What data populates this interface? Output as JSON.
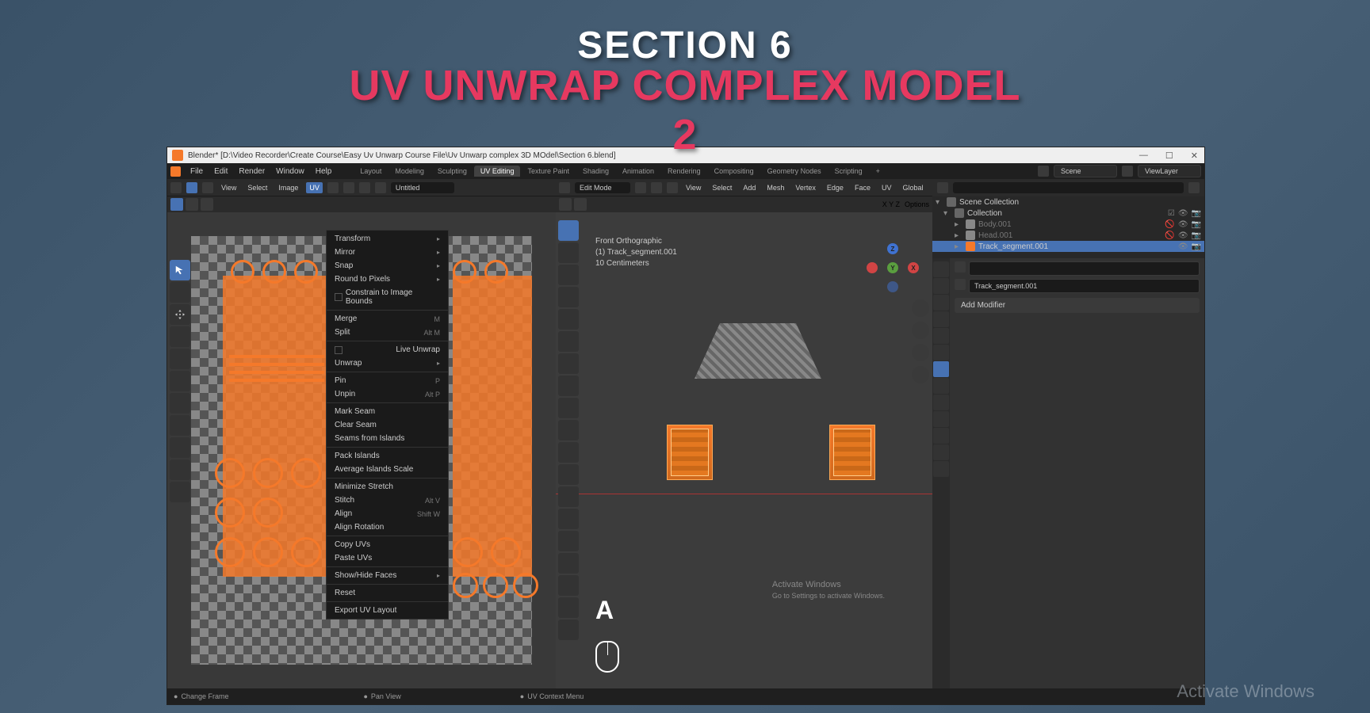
{
  "overlay": {
    "section": "SECTION 6",
    "title": "UV UNWRAP COMPLEX MODEL 2"
  },
  "titlebar": {
    "text": "Blender* [D:\\Video Recorder\\Create Course\\Easy Uv Unwarp Course File\\Uv Unwarp complex 3D MOdel\\Section 6.blend]"
  },
  "topMenu": [
    "File",
    "Edit",
    "Render",
    "Window",
    "Help"
  ],
  "workspaces": [
    "Layout",
    "Modeling",
    "Sculpting",
    "UV Editing",
    "Texture Paint",
    "Shading",
    "Animation",
    "Rendering",
    "Compositing",
    "Geometry Nodes",
    "Scripting"
  ],
  "activeWorkspace": "UV Editing",
  "sceneField": {
    "label": "Scene",
    "value": "Scene"
  },
  "viewLayerField": {
    "label": "ViewLayer",
    "value": "ViewLayer"
  },
  "uvHeader": {
    "menus": [
      "View",
      "Select",
      "Image",
      "UV"
    ],
    "imageName": "Untitled"
  },
  "uvMenu": {
    "items": [
      {
        "label": "Transform",
        "sub": true
      },
      {
        "label": "Mirror",
        "sub": true
      },
      {
        "label": "Snap",
        "sub": true
      },
      {
        "label": "Round to Pixels",
        "sub": true
      },
      {
        "label": "Constrain to Image Bounds",
        "check": true
      },
      {
        "sep": true
      },
      {
        "label": "Merge",
        "shortcut": "M",
        "sub": true
      },
      {
        "label": "Split",
        "shortcut": "Alt M",
        "sub": true
      },
      {
        "sep": true
      },
      {
        "label": "Live Unwrap",
        "check": true
      },
      {
        "label": "Unwrap",
        "sub": true
      },
      {
        "sep": true
      },
      {
        "label": "Pin",
        "shortcut": "P"
      },
      {
        "label": "Unpin",
        "shortcut": "Alt P"
      },
      {
        "sep": true
      },
      {
        "label": "Mark Seam"
      },
      {
        "label": "Clear Seam"
      },
      {
        "label": "Seams from Islands"
      },
      {
        "sep": true
      },
      {
        "label": "Pack Islands"
      },
      {
        "label": "Average Islands Scale"
      },
      {
        "sep": true
      },
      {
        "label": "Minimize Stretch"
      },
      {
        "label": "Stitch",
        "shortcut": "Alt V"
      },
      {
        "label": "Align",
        "shortcut": "Shift W",
        "sub": true
      },
      {
        "label": "Align Rotation"
      },
      {
        "sep": true
      },
      {
        "label": "Copy UVs"
      },
      {
        "label": "Paste UVs"
      },
      {
        "sep": true
      },
      {
        "label": "Show/Hide Faces",
        "sub": true
      },
      {
        "sep": true
      },
      {
        "label": "Reset"
      },
      {
        "sep": true
      },
      {
        "label": "Export UV Layout"
      }
    ]
  },
  "viewportHeader": {
    "mode": "Edit Mode",
    "menus": [
      "View",
      "Select",
      "Add",
      "Mesh",
      "Vertex",
      "Edge",
      "Face",
      "UV"
    ],
    "orient": "Global",
    "options": "Options"
  },
  "viewportInfo": {
    "line1": "Front Orthographic",
    "line2": "(1) Track_segment.001",
    "line3": "10 Centimeters"
  },
  "xyzLabel": "X Y Z",
  "keyPressed": "A",
  "outliner": {
    "root": "Scene Collection",
    "collection": "Collection",
    "items": [
      {
        "name": "Body.001",
        "active": false,
        "hidden": true
      },
      {
        "name": "Head.001",
        "active": false,
        "hidden": true
      },
      {
        "name": "Track_segment.001",
        "active": true,
        "hidden": false
      }
    ]
  },
  "properties": {
    "objectName": "Track_segment.001",
    "addModifier": "Add Modifier"
  },
  "statusbar": {
    "left": "Change Frame",
    "mid": "Pan View",
    "right": "UV Context Menu"
  },
  "watermark": {
    "title": "Activate Windows",
    "sub": "Go to Settings to activate Windows."
  },
  "outerWatermark": "Activate Windows"
}
